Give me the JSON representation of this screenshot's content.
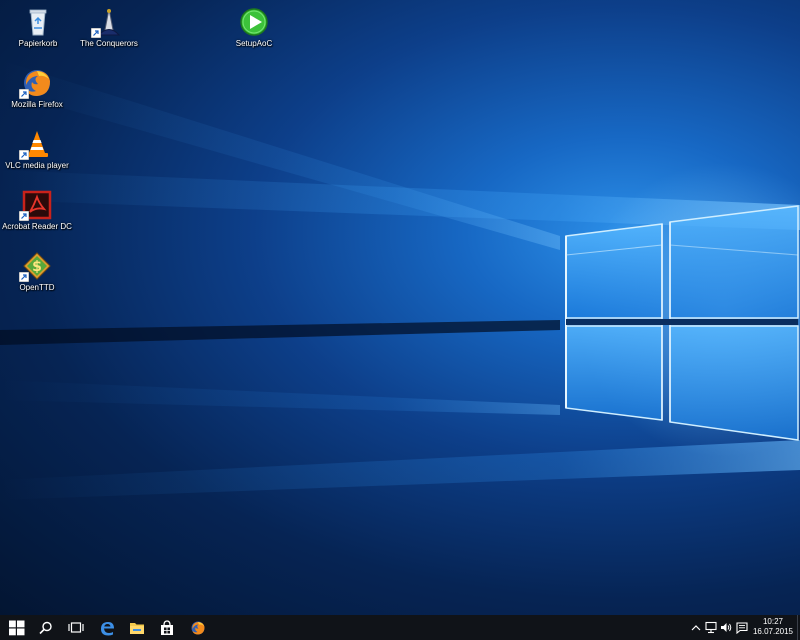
{
  "desktop": {
    "icons": [
      {
        "label": "Papierkorb",
        "icon": "recycle-bin-icon",
        "shortcut": false
      },
      {
        "label": "The Conquerors",
        "icon": "age-of-empires-icon",
        "shortcut": true
      },
      {
        "label": "SetupAoC",
        "icon": "play-setup-icon",
        "shortcut": false
      },
      {
        "label": "Mozilla Firefox",
        "icon": "firefox-icon",
        "shortcut": true
      },
      {
        "label": "VLC media player",
        "icon": "vlc-icon",
        "shortcut": true
      },
      {
        "label": "Acrobat Reader DC",
        "icon": "acrobat-icon",
        "shortcut": true
      },
      {
        "label": "OpenTTD",
        "icon": "openttd-icon",
        "shortcut": true
      }
    ]
  },
  "taskbar": {
    "buttons": [
      {
        "icon": "windows-start-icon"
      },
      {
        "icon": "search-icon"
      },
      {
        "icon": "task-view-icon"
      },
      {
        "icon": "edge-icon"
      },
      {
        "icon": "file-explorer-icon"
      },
      {
        "icon": "store-icon"
      },
      {
        "icon": "firefox-icon"
      }
    ],
    "tray": {
      "icons": [
        "chevron-up-icon",
        "network-icon",
        "volume-icon",
        "action-center-icon"
      ],
      "time": "10:27",
      "date": "16.07.2015"
    }
  },
  "colors": {
    "taskbar": "#101318",
    "wallpaper_accent": "#2c8fe8",
    "wallpaper_dark": "#031532"
  }
}
